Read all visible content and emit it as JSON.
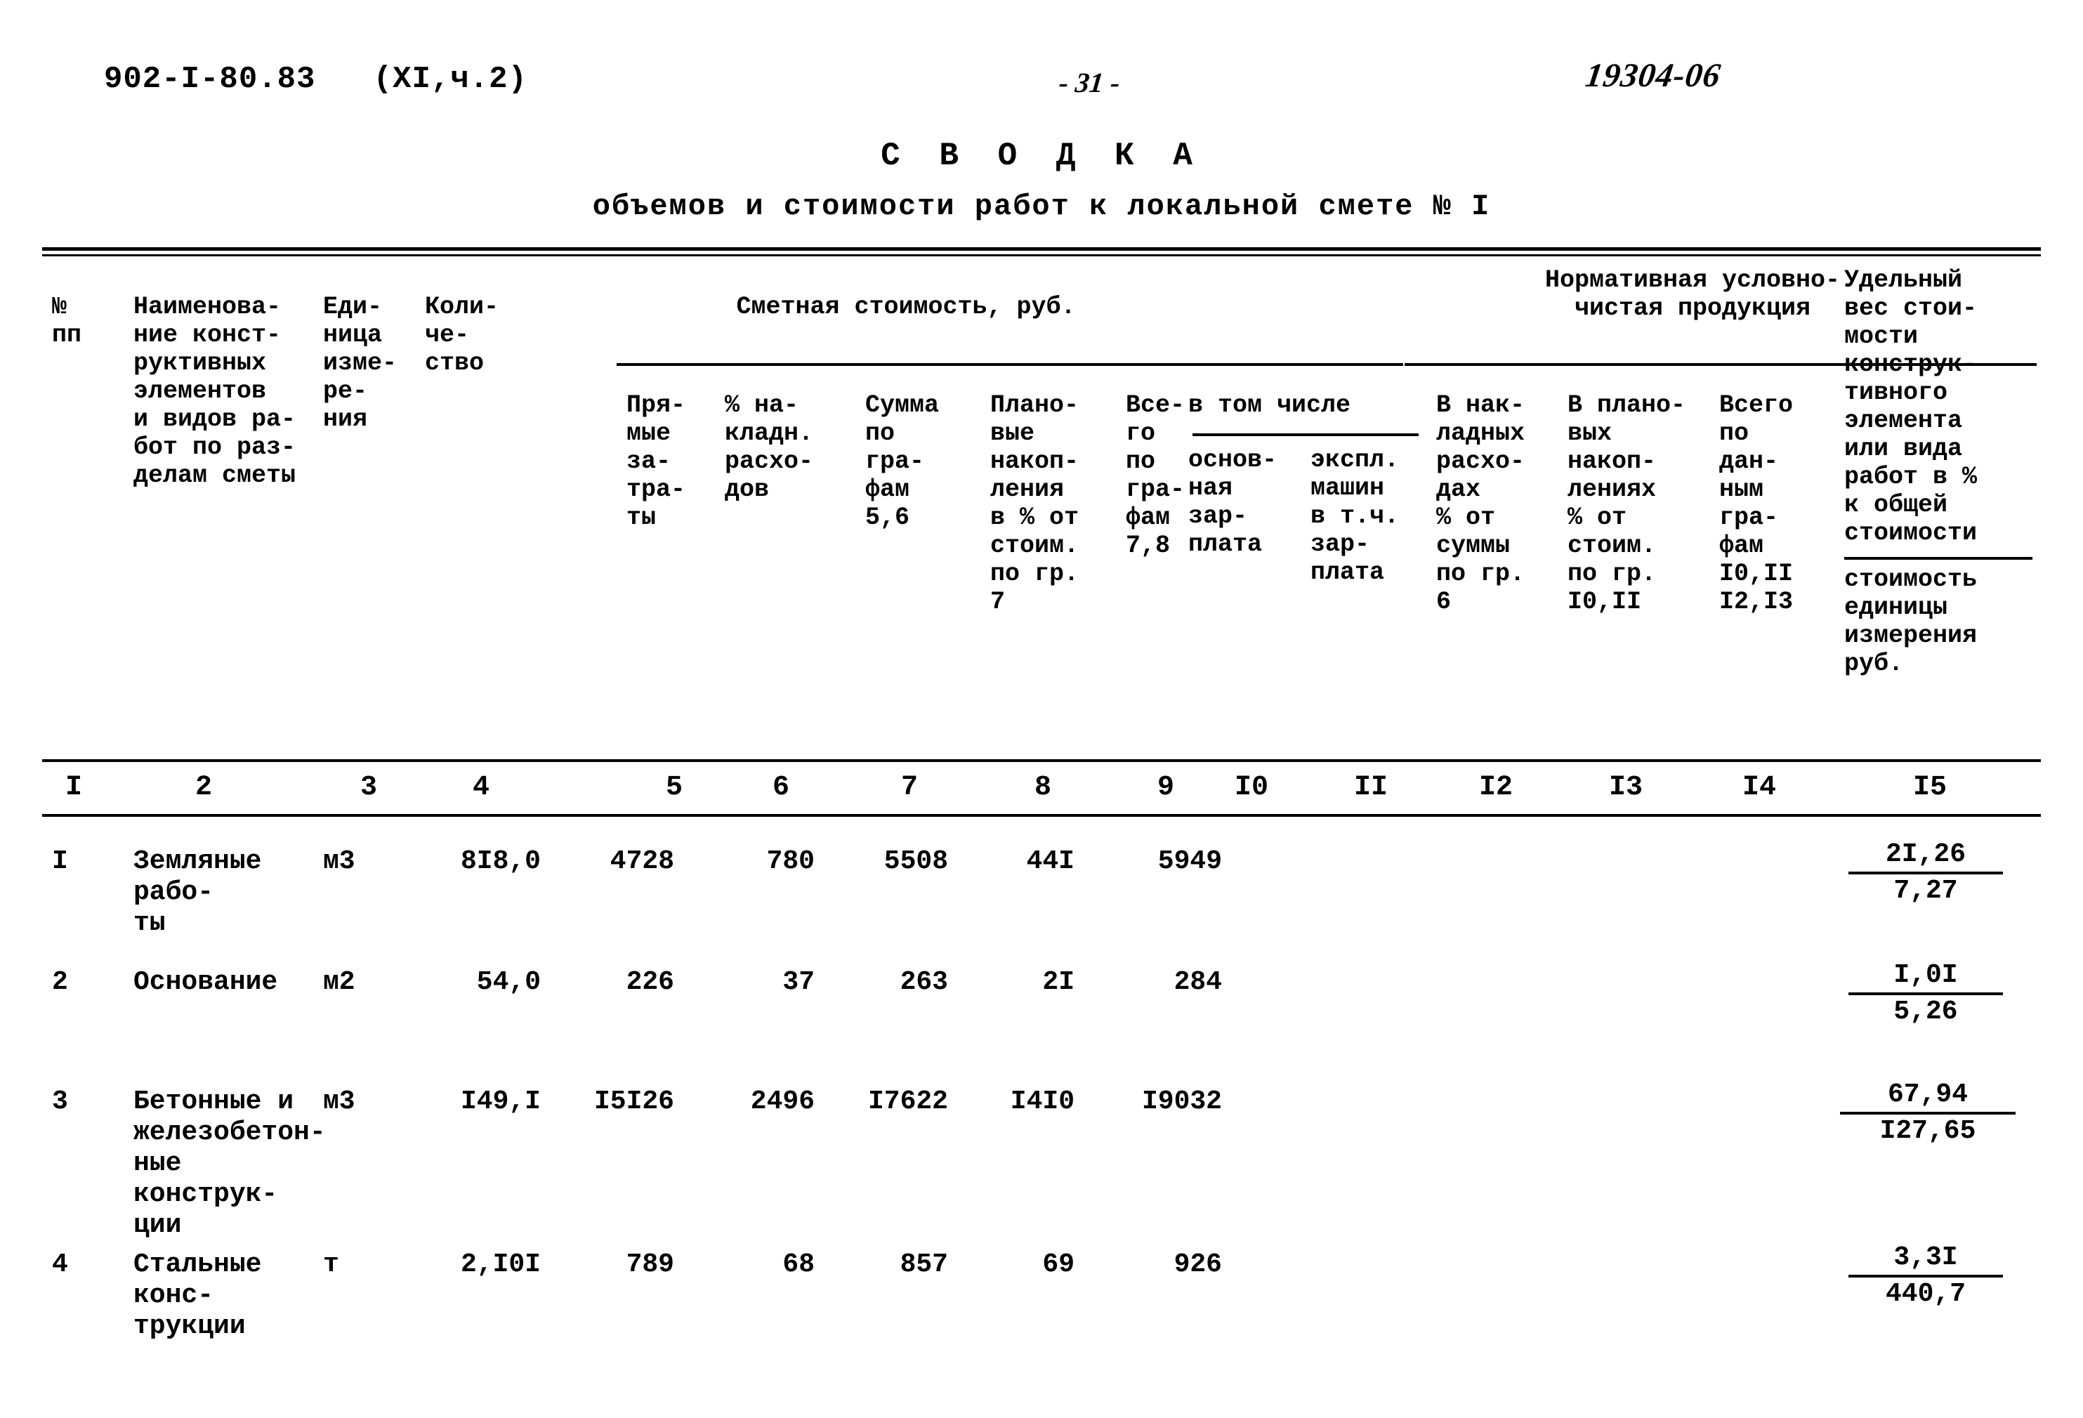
{
  "header": {
    "doc_code": "902-I-80.83   (XI,ч.2)",
    "page_number": "- 31 -",
    "hand_code": "19304-06"
  },
  "title": {
    "main": "С В О Д К А",
    "sub": "объемов и стоимости работ к локальной смете № I"
  },
  "table": {
    "spanners": {
      "smetnaya": "Сметная стоимость, руб.",
      "normativnaya": "Нормативная условно-\nчистая продукция",
      "v_tom_chisle": "в том числе"
    },
    "columns": [
      {
        "num": "I",
        "head": "№\nпп"
      },
      {
        "num": "2",
        "head": "Наименова-\nние конст-\nруктивных\nэлементов\nи видов ра-\nбот по раз-\nделам сметы"
      },
      {
        "num": "3",
        "head": "Еди-\nница\nизме-\nре-\nния"
      },
      {
        "num": "4",
        "head": "Коли-\nче-\nство"
      },
      {
        "num": "5",
        "head": "Пря-\nмые\nза-\nтра-\nты"
      },
      {
        "num": "6",
        "head": "% на-\nкладн.\nрасхо-\nдов"
      },
      {
        "num": "7",
        "head": "Сумма\nпо\nгра-\nфам\n5,6"
      },
      {
        "num": "8",
        "head": "Плано-\nвые\nнакоп-\nления\nв % от\nстоим.\nпо гр.\n7"
      },
      {
        "num": "9",
        "head": "Все-\nго\nпо\nгра-\nфам\n7,8"
      },
      {
        "num": "I0",
        "head": "основ-\nная\nзар-\nплата"
      },
      {
        "num": "II",
        "head": "экспл.\nмашин\nв т.ч.\nзар-\nплата"
      },
      {
        "num": "I2",
        "head": "В нак-\nладных\nрасхо-\nдах\n% от\nсуммы\nпо гр.\n6"
      },
      {
        "num": "I3",
        "head": "В плано-\nвых\nнакоп-\nлениях\n% от\nстоим.\nпо гр.\nI0,II"
      },
      {
        "num": "I4",
        "head": "Всего\nпо\nдан-\nным\nгра-\nфам\nI0,II\nI2,I3"
      },
      {
        "num": "I5",
        "head_top": "Удельный\nвес стои-\nмости\nконструк-\nтивного\nэлемента\nили вида\nработ в %\nк общей\nстоимости",
        "head_bot": "стоимость\nединицы\nизмерения\nруб."
      }
    ],
    "rows": [
      {
        "c1": "I",
        "c2": "Земляные рабо-\nты",
        "c3": "м3",
        "c4": "8I8,0",
        "c5": "4728",
        "c6": "780",
        "c7": "5508",
        "c8": "44I",
        "c9": "5949",
        "c10": "",
        "c11": "",
        "c12": "",
        "c13": "",
        "c14": "",
        "c15_top": "2I,26",
        "c15_bot": "7,27"
      },
      {
        "c1": "2",
        "c2": "Основание",
        "c3": "м2",
        "c4": "54,0",
        "c5": "226",
        "c6": "37",
        "c7": "263",
        "c8": "2I",
        "c9": "284",
        "c10": "",
        "c11": "",
        "c12": "",
        "c13": "",
        "c14": "",
        "c15_top": "I,0I",
        "c15_bot": "5,26"
      },
      {
        "c1": "3",
        "c2": "Бетонные и\nжелезобетон-\nные конструк-\nции",
        "c3": "м3",
        "c4": "I49,I",
        "c5": "I5I26",
        "c6": "2496",
        "c7": "I7622",
        "c8": "I4I0",
        "c9": "I9032",
        "c10": "",
        "c11": "",
        "c12": "",
        "c13": "",
        "c14": "",
        "c15_top": "67,94",
        "c15_bot": "I27,65"
      },
      {
        "c1": "4",
        "c2": "Стальные конс-\nтрукции",
        "c3": "т",
        "c4": "2,I0I",
        "c5": "789",
        "c6": "68",
        "c7": "857",
        "c8": "69",
        "c9": "926",
        "c10": "",
        "c11": "",
        "c12": "",
        "c13": "",
        "c14": "",
        "c15_top": "3,3I",
        "c15_bot": "440,7"
      }
    ]
  }
}
